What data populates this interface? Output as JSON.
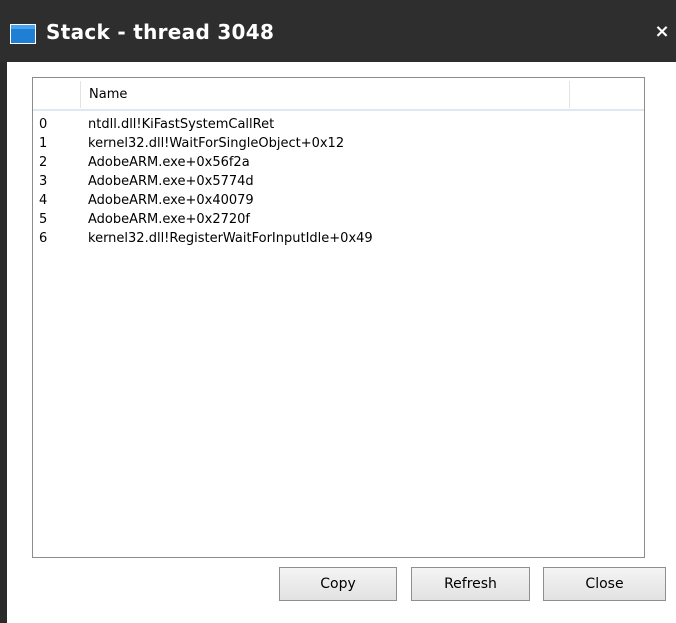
{
  "window": {
    "title": "Stack - thread 3048",
    "close_glyph": "×"
  },
  "icons": {
    "window_icon": "window-icon",
    "close_icon": "close-icon"
  },
  "list": {
    "columns": [
      "",
      "Name"
    ],
    "rows": [
      {
        "index": "0",
        "name": "ntdll.dll!KiFastSystemCallRet"
      },
      {
        "index": "1",
        "name": "kernel32.dll!WaitForSingleObject+0x12"
      },
      {
        "index": "2",
        "name": "AdobeARM.exe+0x56f2a"
      },
      {
        "index": "3",
        "name": "AdobeARM.exe+0x5774d"
      },
      {
        "index": "4",
        "name": "AdobeARM.exe+0x40079"
      },
      {
        "index": "5",
        "name": "AdobeARM.exe+0x2720f"
      },
      {
        "index": "6",
        "name": "kernel32.dll!RegisterWaitForInputIdle+0x49"
      }
    ]
  },
  "buttons": {
    "copy": "Copy",
    "refresh": "Refresh",
    "close": "Close"
  },
  "colors": {
    "titlebar": "#2e2e2e",
    "icon_blue": "#1f7fd4",
    "header_line": "#dfe7f2"
  }
}
